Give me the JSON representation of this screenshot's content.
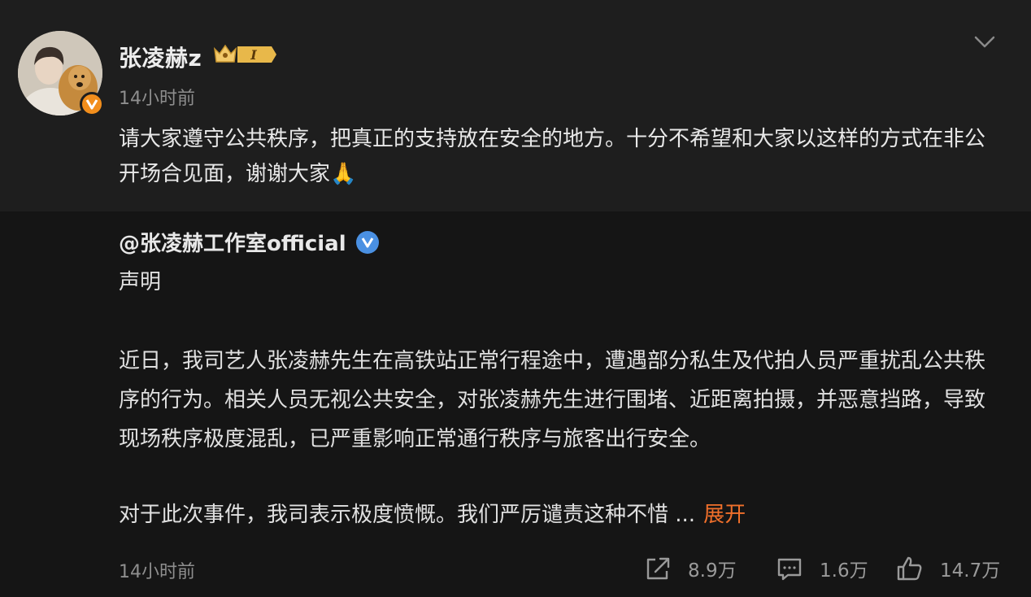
{
  "post": {
    "username": "张凌赫z",
    "badge_level": "I",
    "time": "14小时前",
    "text": "请大家遵守公共秩序，把真正的支持放在安全的地方。十分不希望和大家以这样的方式在非公开场合见面，谢谢大家🙏"
  },
  "retweet": {
    "author": "@张凌赫工作室official",
    "title": "声明",
    "body": "近日，我司艺人张凌赫先生在高铁站正常行程途中，遭遇部分私生及代拍人员严重扰乱公共秩序的行为。相关人员无视公共安全，对张凌赫先生进行围堵、近距离拍摄，并恶意挡路，导致现场秩序极度混乱，已严重影响正常通行秩序与旅客出行安全。",
    "last_line": "对于此次事件，我司表示极度愤慨。我们严厉谴责这种不惜 ...",
    "expand_label": "展开",
    "time": "14小时前"
  },
  "actions": {
    "share_count": "8.9万",
    "comment_count": "1.6万",
    "like_count": "14.7万"
  },
  "icons": [
    "chevron-down-icon",
    "crown-badge-icon",
    "verified-orange-icon",
    "verified-blue-icon",
    "share-icon",
    "comment-icon",
    "like-icon"
  ],
  "colors": {
    "accent_orange": "#f1702b",
    "verified_blue": "#4a90e2",
    "gold": "#e8b84a"
  }
}
